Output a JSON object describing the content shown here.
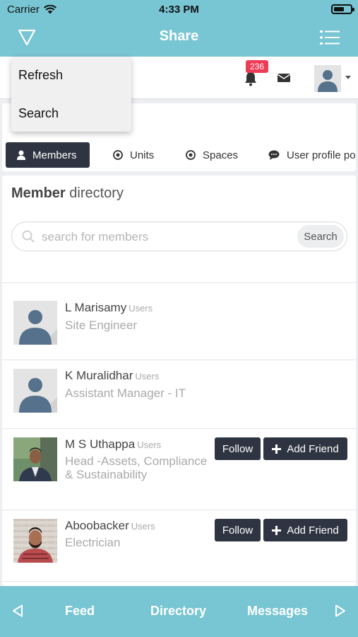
{
  "status_bar": {
    "carrier": "Carrier",
    "time": "4:33 PM"
  },
  "nav": {
    "title": "Share",
    "left_icon": "filter-funnel-icon",
    "right_icon": "list-menu-icon"
  },
  "header": {
    "notification_count": "236"
  },
  "menu": {
    "items": [
      {
        "label": "Refresh"
      },
      {
        "label": "Search"
      }
    ]
  },
  "tabs": [
    {
      "label": "Members",
      "icon": "user-icon",
      "active": true
    },
    {
      "label": "Units",
      "icon": "radio-target-icon",
      "active": false
    },
    {
      "label": "Spaces",
      "icon": "radio-target-icon",
      "active": false
    },
    {
      "label": "User profile po",
      "icon": "comment-icon",
      "active": false
    }
  ],
  "directory": {
    "title_bold": "Member",
    "title_rest": "directory",
    "search_placeholder": "search for members",
    "search_button": "Search",
    "members": [
      {
        "name": "L Marisamy",
        "role": "Users",
        "title": "Site Engineer",
        "photo": "placeholder"
      },
      {
        "name": "K Muralidhar",
        "role": "Users",
        "title": "Assistant Manager - IT",
        "photo": "placeholder"
      },
      {
        "name": "M S Uthappa",
        "role": "Users",
        "title": "Head -Assets, Compliance & Sustainability",
        "photo": "photo",
        "follow": "Follow",
        "add_friend": "Add Friend"
      },
      {
        "name": "Aboobacker",
        "role": "Users",
        "title": "Electrician",
        "photo": "photo",
        "follow": "Follow",
        "add_friend": "Add Friend"
      }
    ]
  },
  "bottom_bar": {
    "items": [
      {
        "label": "Feed"
      },
      {
        "label": "Directory"
      },
      {
        "label": "Messages"
      }
    ]
  },
  "colors": {
    "accent": "#78c5d3",
    "dark_button": "#2e3441",
    "badge": "#ee3b56"
  }
}
